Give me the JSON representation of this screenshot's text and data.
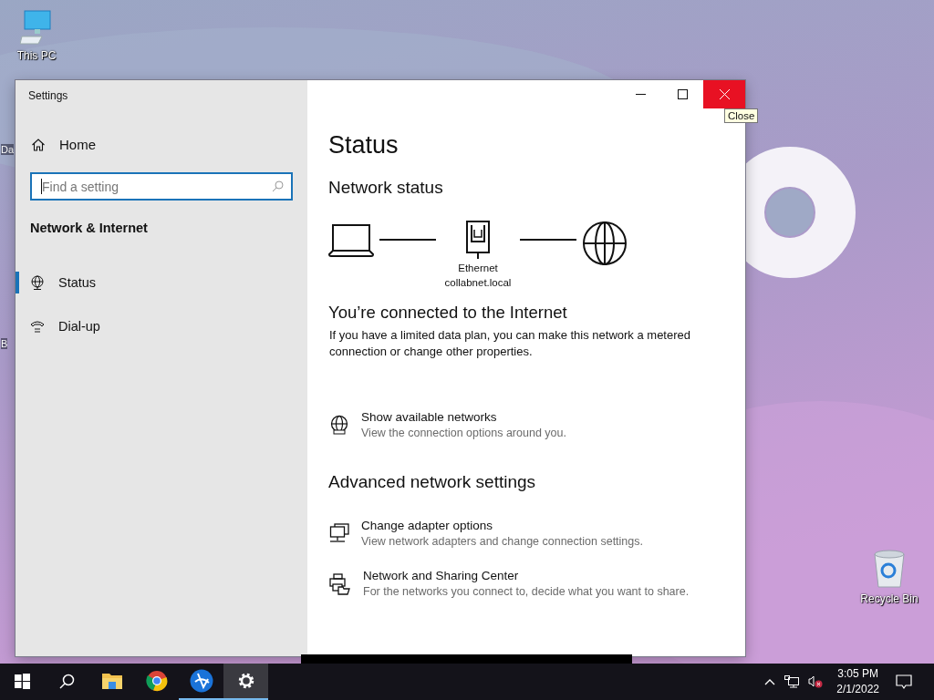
{
  "desktop": {
    "icons": [
      {
        "kind": "computer",
        "label": "This PC"
      },
      {
        "kind": "recycle",
        "label": "Recycle Bin"
      }
    ],
    "partial_labels": [
      "Da",
      "B"
    ]
  },
  "window": {
    "title": "Settings",
    "close_tooltip": "Close"
  },
  "sidebar": {
    "home": "Home",
    "search": {
      "placeholder": "Find a setting"
    },
    "section": "Network & Internet",
    "items": [
      {
        "kind": "globe",
        "label": "Status",
        "selected": true
      },
      {
        "kind": "phone",
        "label": "Dial-up",
        "selected": false
      }
    ]
  },
  "main": {
    "title": "Status",
    "network_status": "Network status",
    "adapter": "Ethernet",
    "network_name": "collabnet.local",
    "connection_heading": "You’re connected to the Internet",
    "connection_text": "If you have a limited data plan, you can make this network a metered connection or change other properties.",
    "links": [
      {
        "kind": "globe",
        "title": "Show available networks",
        "description": "View the connection options around you."
      }
    ],
    "advanced_heading": "Advanced network settings",
    "advanced_links": [
      {
        "kind": "adapter",
        "title": "Change adapter options",
        "description": "View network adapters and change connection settings."
      },
      {
        "kind": "sharing",
        "title": "Network and Sharing Center",
        "description": "For the networks you connect to, decide what you want to share."
      }
    ]
  },
  "taskbar": {
    "apps": [
      {
        "kind": "explorer",
        "running": false,
        "selected": false
      },
      {
        "kind": "chrome",
        "running": false,
        "selected": false
      },
      {
        "kind": "blueapp",
        "running": true,
        "selected": false
      },
      {
        "kind": "settings",
        "running": true,
        "selected": true
      }
    ],
    "time": "3:05 PM",
    "date": "2/1/2022"
  }
}
